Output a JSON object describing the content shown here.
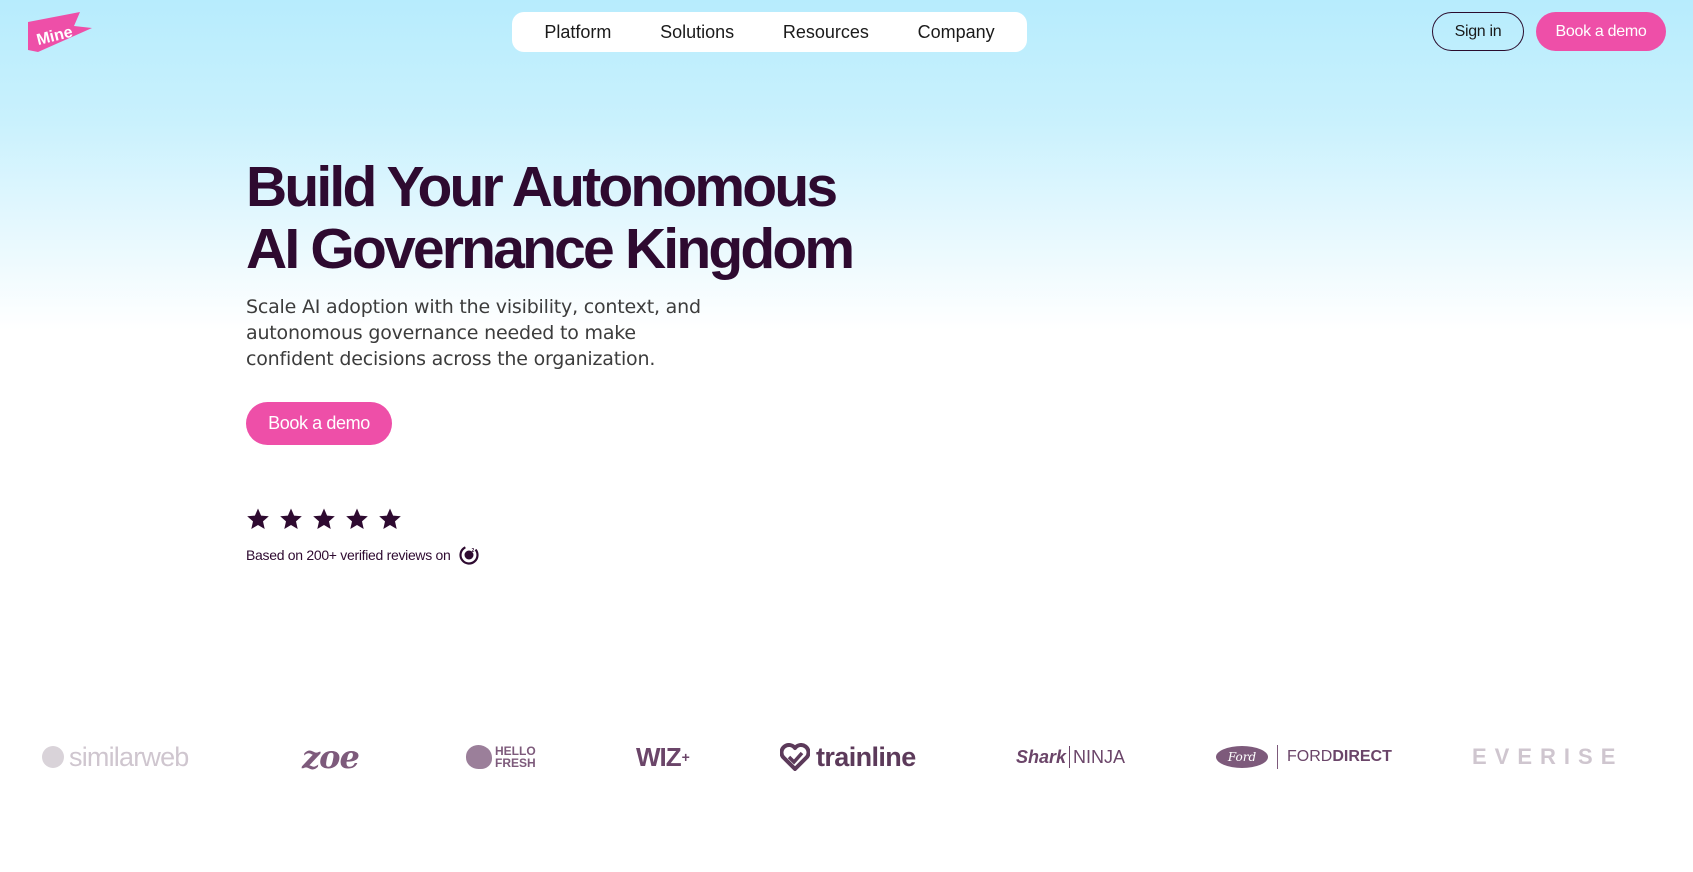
{
  "header": {
    "logo_text": "Mine",
    "nav": [
      {
        "label": "Platform"
      },
      {
        "label": "Solutions"
      },
      {
        "label": "Resources"
      },
      {
        "label": "Company"
      }
    ],
    "sign_in_label": "Sign in",
    "book_demo_label": "Book a demo"
  },
  "hero": {
    "title_line1": "Build Your Autonomous",
    "title_line2": "AI Governance Kingdom",
    "subtitle": "Scale AI adoption with the visibility, context, and autonomous governance needed to make confident decisions across the organization.",
    "cta_label": "Book a demo",
    "rating_stars": 5,
    "reviews_text": "Based on 200+ verified reviews on",
    "review_platform_icon": "g2-icon"
  },
  "clients": {
    "logos": [
      {
        "name": "similarweb",
        "text": "similarweb"
      },
      {
        "name": "zoe",
        "text": "zoe"
      },
      {
        "name": "hellofresh",
        "line1": "HELLO",
        "line2": "FRESH"
      },
      {
        "name": "wiz",
        "text": "WIZ",
        "mark": "+"
      },
      {
        "name": "trainline",
        "text": "trainline"
      },
      {
        "name": "sharkninja",
        "part1": "Shark",
        "part2": "NINJA"
      },
      {
        "name": "forddirect",
        "oval": "Ford",
        "part1": "FORD",
        "part2": "DIRECT"
      },
      {
        "name": "everise",
        "text": "EVERISE"
      }
    ]
  },
  "colors": {
    "brand_pink": "#ee4fa8",
    "headline": "#2e0a30",
    "sky": "#b7ecfd"
  }
}
